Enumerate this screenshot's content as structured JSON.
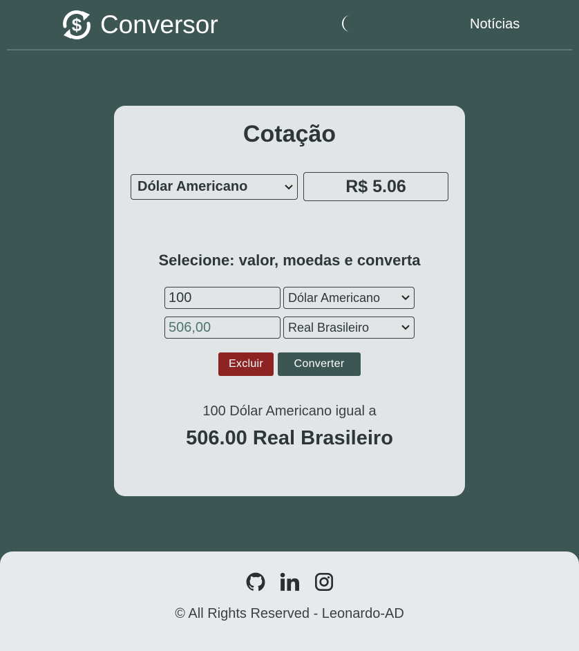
{
  "header": {
    "brand": "Conversor",
    "nav_news": "Notícias"
  },
  "card": {
    "title": "Cotação",
    "quote_currency": "Dólar Americano",
    "quote_value": "R$ 5.06",
    "subtitle": "Selecione: valor, moedas e converta",
    "from_amount": "100",
    "from_currency": "Dólar Americano",
    "to_amount": "506,00",
    "to_currency": "Real Brasileiro",
    "clear_label": "Excluir",
    "convert_label": "Converter",
    "result_line": "100 Dólar Americano igual a",
    "result_value": "506.00 Real Brasileiro"
  },
  "footer": {
    "icons": [
      "github-icon",
      "linkedin-icon",
      "instagram-icon"
    ],
    "copyright": "© All Rights Reserved - Leonardo-AD"
  },
  "colors": {
    "background": "#3c5654",
    "card": "#e1e5e6",
    "danger": "#8c2424",
    "primary": "#3c5654"
  }
}
